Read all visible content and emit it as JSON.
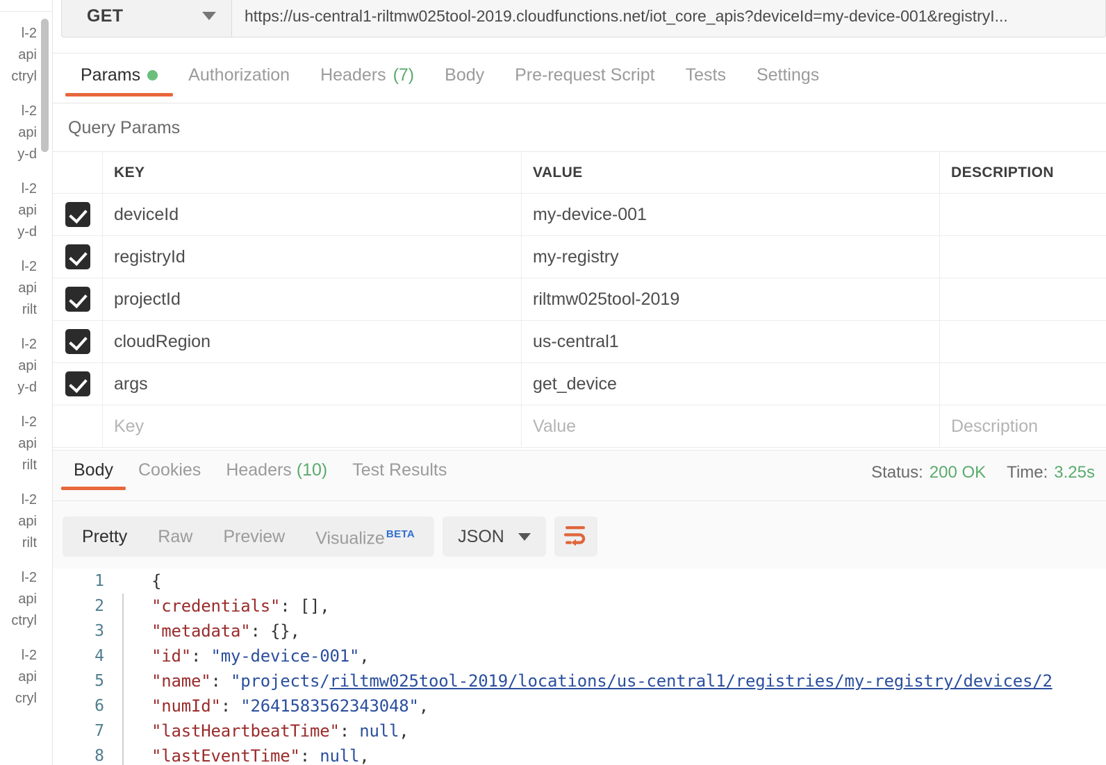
{
  "sidebar": {
    "items": [
      {
        "l1": "l-2",
        "l2": "api",
        "l3": "ctryl"
      },
      {
        "l1": "l-2",
        "l2": "api",
        "l3": "y-d"
      },
      {
        "l1": "l-2",
        "l2": "api",
        "l3": "y-d"
      },
      {
        "l1": "l-2",
        "l2": "api",
        "l3": "rilt"
      },
      {
        "l1": "l-2",
        "l2": "api",
        "l3": "y-d"
      },
      {
        "l1": "l-2",
        "l2": "api",
        "l3": "rilt"
      },
      {
        "l1": "l-2",
        "l2": "api",
        "l3": "rilt"
      },
      {
        "l1": "l-2",
        "l2": "api",
        "l3": "ctryl"
      },
      {
        "l1": "l-2",
        "l2": "api",
        "l3": "cryl"
      }
    ]
  },
  "request": {
    "method": "GET",
    "url": "https://us-central1-riltmw025tool-2019.cloudfunctions.net/iot_core_apis?deviceId=my-device-001&registryI...",
    "tabs": [
      {
        "label": "Params",
        "count": "",
        "dot": true,
        "active": true
      },
      {
        "label": "Authorization",
        "count": "",
        "dot": false,
        "active": false
      },
      {
        "label": "Headers",
        "count": "(7)",
        "dot": false,
        "active": false
      },
      {
        "label": "Body",
        "count": "",
        "dot": false,
        "active": false
      },
      {
        "label": "Pre-request Script",
        "count": "",
        "dot": false,
        "active": false
      },
      {
        "label": "Tests",
        "count": "",
        "dot": false,
        "active": false
      },
      {
        "label": "Settings",
        "count": "",
        "dot": false,
        "active": false
      }
    ]
  },
  "query_params": {
    "heading": "Query Params",
    "columns": {
      "key": "KEY",
      "value": "VALUE",
      "description": "DESCRIPTION"
    },
    "rows": [
      {
        "checked": true,
        "key": "deviceId",
        "value": "my-device-001",
        "description": ""
      },
      {
        "checked": true,
        "key": "registryId",
        "value": "my-registry",
        "description": ""
      },
      {
        "checked": true,
        "key": "projectId",
        "value": "riltmw025tool-2019",
        "description": ""
      },
      {
        "checked": true,
        "key": "cloudRegion",
        "value": "us-central1",
        "description": ""
      },
      {
        "checked": true,
        "key": "args",
        "value": "get_device",
        "description": ""
      }
    ],
    "empty_row": {
      "key": "Key",
      "value": "Value",
      "description": "Description"
    }
  },
  "response": {
    "tabs": [
      {
        "label": "Body",
        "count": "",
        "active": true
      },
      {
        "label": "Cookies",
        "count": "",
        "active": false
      },
      {
        "label": "Headers",
        "count": "(10)",
        "active": false
      },
      {
        "label": "Test Results",
        "count": "",
        "active": false
      }
    ],
    "status_label": "Status:",
    "status_value": "200 OK",
    "time_label": "Time:",
    "time_value": "3.25s",
    "format_buttons": [
      {
        "label": "Pretty",
        "active": true
      },
      {
        "label": "Raw",
        "active": false
      },
      {
        "label": "Preview",
        "active": false
      },
      {
        "label": "Visualize",
        "active": false,
        "badge": "BETA"
      }
    ],
    "content_type": "JSON",
    "wrap_icon": "word-wrap-icon",
    "body_lines": [
      {
        "n": "1",
        "fold": false,
        "indent": 0,
        "tokens": [
          {
            "t": "{",
            "c": "p"
          }
        ]
      },
      {
        "n": "2",
        "fold": true,
        "indent": 1,
        "tokens": [
          {
            "t": "\"credentials\"",
            "c": "k"
          },
          {
            "t": ": ",
            "c": "p"
          },
          {
            "t": "[]",
            "c": "p"
          },
          {
            "t": ",",
            "c": "p"
          }
        ]
      },
      {
        "n": "3",
        "fold": true,
        "indent": 1,
        "tokens": [
          {
            "t": "\"metadata\"",
            "c": "k"
          },
          {
            "t": ": ",
            "c": "p"
          },
          {
            "t": "{}",
            "c": "p"
          },
          {
            "t": ",",
            "c": "p"
          }
        ]
      },
      {
        "n": "4",
        "fold": true,
        "indent": 1,
        "tokens": [
          {
            "t": "\"id\"",
            "c": "k"
          },
          {
            "t": ": ",
            "c": "p"
          },
          {
            "t": "\"my-device-001\"",
            "c": "s"
          },
          {
            "t": ",",
            "c": "p"
          }
        ]
      },
      {
        "n": "5",
        "fold": true,
        "indent": 1,
        "tokens": [
          {
            "t": "\"name\"",
            "c": "k"
          },
          {
            "t": ": ",
            "c": "p"
          },
          {
            "t": "\"projects/",
            "c": "s"
          },
          {
            "t": "riltmw025tool-2019/locations/us-central1/registries/my-registry/devices/2",
            "c": "lnk"
          }
        ]
      },
      {
        "n": "6",
        "fold": true,
        "indent": 1,
        "tokens": [
          {
            "t": "\"numId\"",
            "c": "k"
          },
          {
            "t": ": ",
            "c": "p"
          },
          {
            "t": "\"2641583562343048\"",
            "c": "s"
          },
          {
            "t": ",",
            "c": "p"
          }
        ]
      },
      {
        "n": "7",
        "fold": true,
        "indent": 1,
        "tokens": [
          {
            "t": "\"lastHeartbeatTime\"",
            "c": "k"
          },
          {
            "t": ": ",
            "c": "p"
          },
          {
            "t": "null",
            "c": "lit"
          },
          {
            "t": ",",
            "c": "p"
          }
        ]
      },
      {
        "n": "8",
        "fold": true,
        "indent": 1,
        "tokens": [
          {
            "t": "\"lastEventTime\"",
            "c": "k"
          },
          {
            "t": ": ",
            "c": "p"
          },
          {
            "t": "null",
            "c": "lit"
          },
          {
            "t": ",",
            "c": "p"
          }
        ]
      }
    ]
  },
  "colors": {
    "accent_orange": "#e8663c",
    "status_green": "#5aab6e",
    "param_dot_green": "#6bbf7b",
    "beta_blue": "#2f6fd0",
    "json_key_red": "#9b2c2c",
    "json_string_blue": "#2b4f9e",
    "checkbox_dark": "#2b2b2b"
  }
}
